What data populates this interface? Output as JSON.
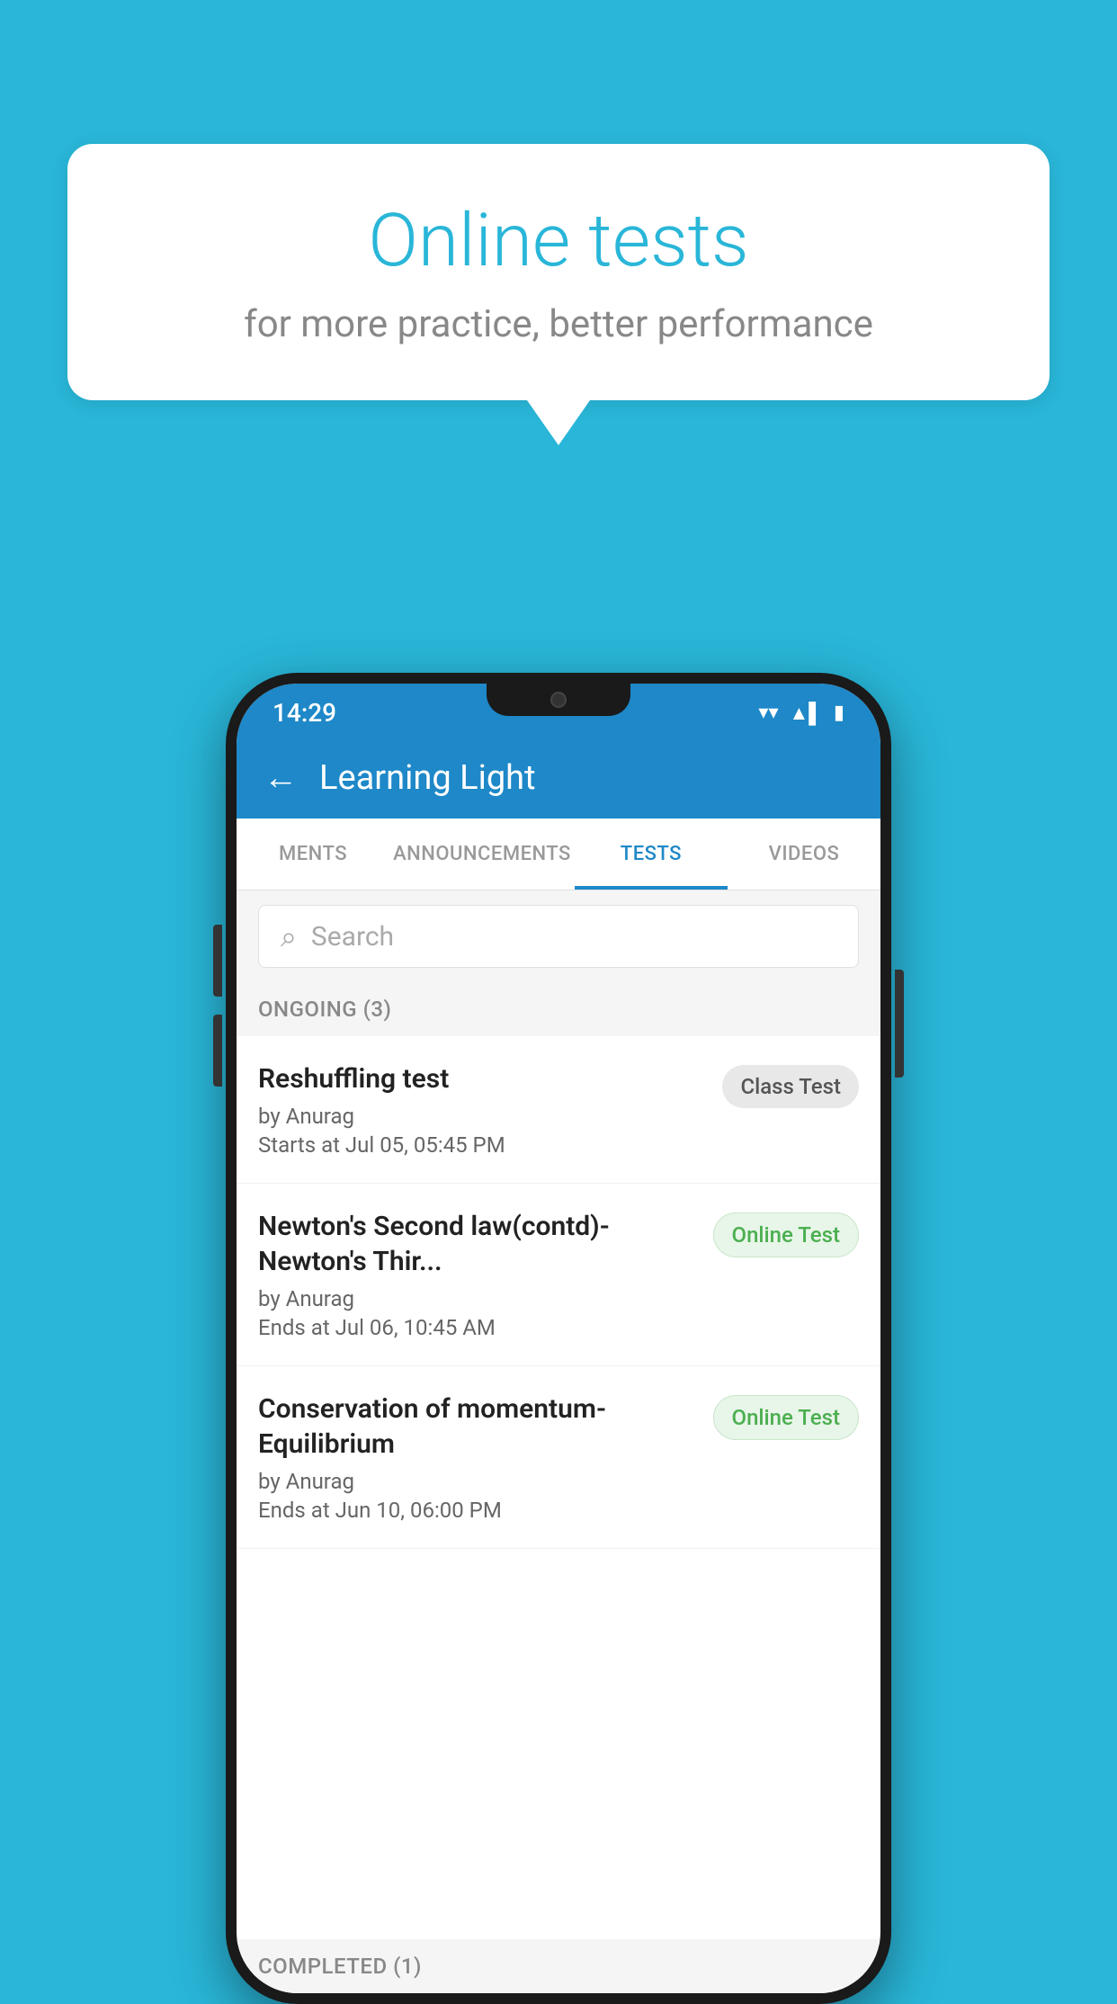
{
  "background_color": "#29B6D8",
  "speech_bubble": {
    "title": "Online tests",
    "subtitle": "for more practice, better performance"
  },
  "phone": {
    "status_bar": {
      "time": "14:29",
      "wifi": "▾",
      "signal": "▲",
      "battery": "▮"
    },
    "header": {
      "back_label": "←",
      "title": "Learning Light"
    },
    "tabs": [
      {
        "label": "MENTS",
        "active": false
      },
      {
        "label": "ANNOUNCEMENTS",
        "active": false
      },
      {
        "label": "TESTS",
        "active": true
      },
      {
        "label": "VIDEOS",
        "active": false
      }
    ],
    "search": {
      "placeholder": "Search"
    },
    "ongoing_section": {
      "label": "ONGOING (3)"
    },
    "tests": [
      {
        "name": "Reshuffling test",
        "author": "by Anurag",
        "date": "Starts at  Jul 05, 05:45 PM",
        "badge": "Class Test",
        "badge_type": "class"
      },
      {
        "name": "Newton's Second law(contd)-Newton's Thir...",
        "author": "by Anurag",
        "date": "Ends at  Jul 06, 10:45 AM",
        "badge": "Online Test",
        "badge_type": "online"
      },
      {
        "name": "Conservation of momentum-Equilibrium",
        "author": "by Anurag",
        "date": "Ends at  Jun 10, 06:00 PM",
        "badge": "Online Test",
        "badge_type": "online"
      }
    ],
    "completed_section": {
      "label": "COMPLETED (1)"
    }
  }
}
